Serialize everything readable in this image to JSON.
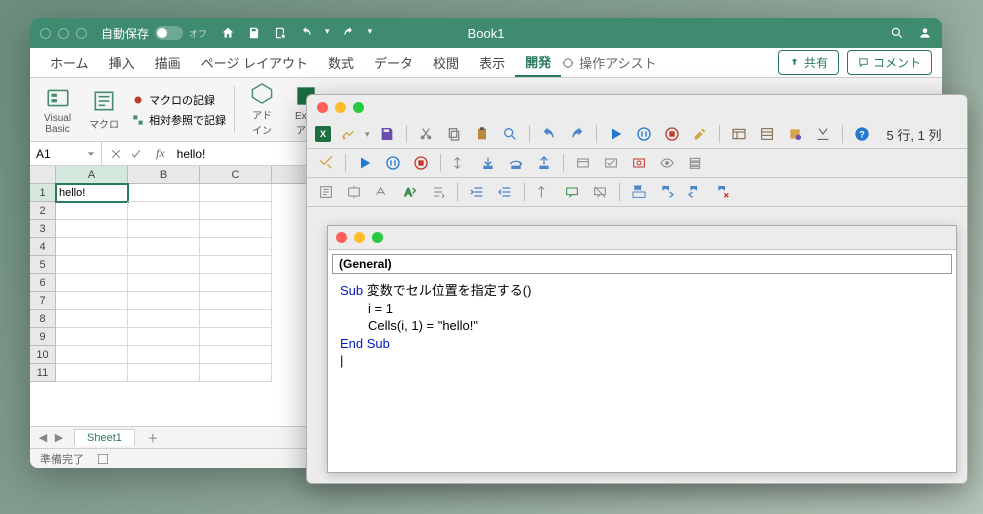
{
  "excel": {
    "title": "Book1",
    "autosave_label": "自動保存",
    "autosave_state": "オフ",
    "tabs": [
      "ホーム",
      "挿入",
      "描画",
      "ページ レイアウト",
      "数式",
      "データ",
      "校閲",
      "表示",
      "開発"
    ],
    "active_tab": "開発",
    "assist_label": "操作アシスト",
    "share_label": "共有",
    "comment_label": "コメント",
    "ribbon": {
      "visual_basic": "Visual\nBasic",
      "macro": "マクロ",
      "record_macro": "マクロの記録",
      "relative_ref": "相対参照で記録",
      "addin": "アド\nイン",
      "excel_addin": "Exce\nアド"
    },
    "namebox": "A1",
    "formula": "hello!",
    "columns": [
      "A",
      "B",
      "C"
    ],
    "rows": [
      1,
      2,
      3,
      4,
      5,
      6,
      7,
      8,
      9,
      10,
      11
    ],
    "cell_a1": "hello!",
    "sheet_tab": "Sheet1",
    "status": "準備完了"
  },
  "vbe": {
    "cursor_status": "5 行, 1 列",
    "object_box": "(General)",
    "code": {
      "sub_kw": "Sub",
      "sub_name": " 変数でセル位置を指定する()",
      "line1": "i = 1",
      "line2": "Cells(i, 1) = \"hello!\"",
      "end_kw": "End Sub"
    }
  }
}
